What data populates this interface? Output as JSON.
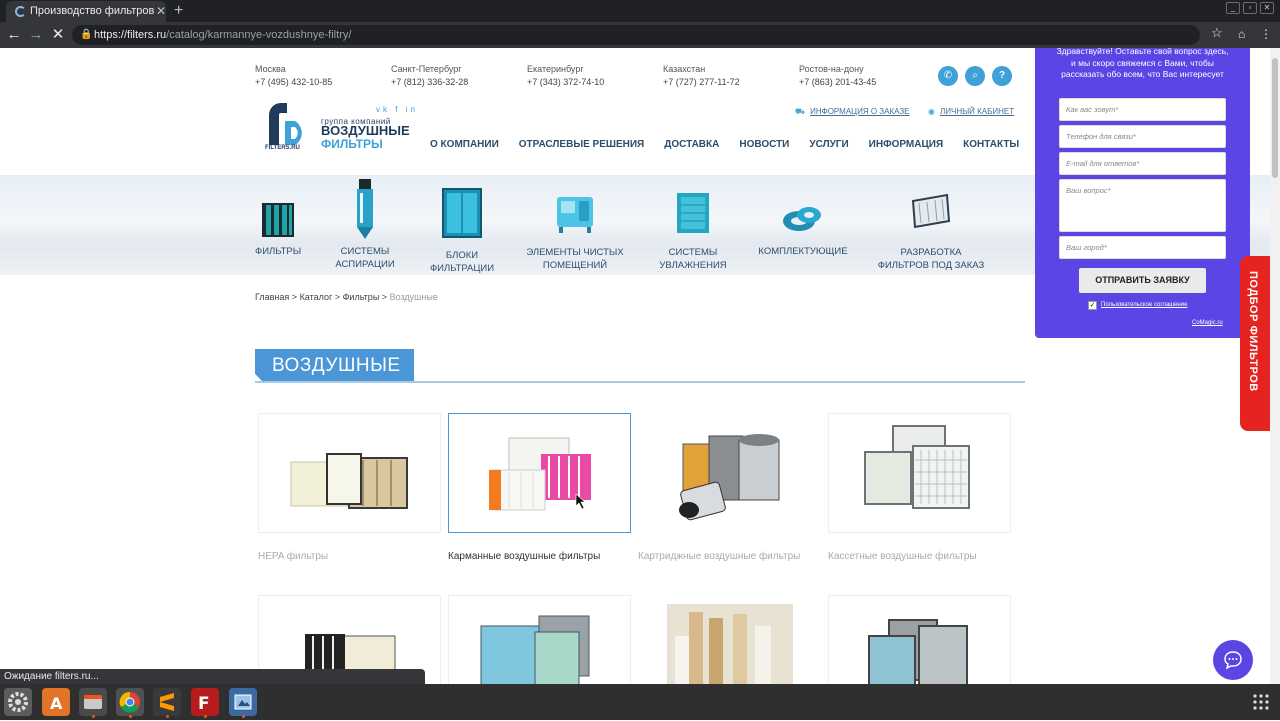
{
  "browser": {
    "tab_title": "Производство фильтров",
    "url_host": "https://filters.ru",
    "url_path": "/catalog/karmannye-vozdushnye-filtry/",
    "status": "Ожидание filters.ru..."
  },
  "contacts": [
    {
      "city": "Москва",
      "phone": "+7 (495) 432-10-85"
    },
    {
      "city": "Санкт-Петербург",
      "phone": "+7 (812) 336-32-28"
    },
    {
      "city": "Екатеринбург",
      "phone": "+7 (343) 372-74-10"
    },
    {
      "city": "Казахстан",
      "phone": "+7 (727) 277-11-72"
    },
    {
      "city": "Ростов-на-дону",
      "phone": "+7 (863) 201-43-45"
    }
  ],
  "logo": {
    "sub": "группа компаний",
    "line1": "ВОЗДУШНЫЕ",
    "line2": "ФИЛЬТРЫ",
    "tag": "FILTERS.RU",
    "social": "vk f in"
  },
  "toplinks": {
    "order_info": "ИНФОРМАЦИЯ О ЗАКАЗЕ",
    "cabinet": "ЛИЧНЫЙ КАБИНЕТ"
  },
  "nav": [
    "О КОМПАНИИ",
    "ОТРАСЛЕВЫЕ РЕШЕНИЯ",
    "ДОСТАВКА",
    "НОВОСТИ",
    "УСЛУГИ",
    "ИНФОРМАЦИЯ",
    "КОНТАКТЫ"
  ],
  "categories": [
    {
      "l1": "ФИЛЬТРЫ",
      "l2": ""
    },
    {
      "l1": "СИСТЕМЫ",
      "l2": "АСПИРАЦИИ"
    },
    {
      "l1": "БЛОКИ",
      "l2": "ФИЛЬТРАЦИИ"
    },
    {
      "l1": "ЭЛЕМЕНТЫ ЧИСТЫХ",
      "l2": "ПОМЕЩЕНИЙ"
    },
    {
      "l1": "СИСТЕМЫ",
      "l2": "УВЛАЖНЕНИЯ"
    },
    {
      "l1": "КОМПЛЕКТУЮЩИЕ",
      "l2": ""
    },
    {
      "l1": "РАЗРАБОТКА",
      "l2": "ФИЛЬТРОВ ПОД ЗАКАЗ"
    }
  ],
  "breadcrumb": {
    "home": "Главная",
    "catalog": "Каталог",
    "filters": "Фильтры",
    "current": "Воздушные",
    "sep": ">"
  },
  "page_title": "ВОЗДУШНЫЕ",
  "products": [
    "HEPA фильтры",
    "Карманные воздушные фильтры",
    "Картриджные воздушные фильтры",
    "Кассетные воздушные фильтры"
  ],
  "widget": {
    "text": "Здравствуйте! Оставьте свой вопрос здесь, и мы скоро свяжемся с Вами, чтобы рассказать обо всем, что Вас интересует",
    "name_ph": "Как вас зовут*",
    "phone_ph": "Телефон для связи*",
    "email_ph": "E-mail для ответов*",
    "question_ph": "Ваш вопрос*",
    "city_ph": "Ваш город*",
    "submit": "ОТПРАВИТЬ ЗАЯВКУ",
    "agreement": "Пользовательское соглашение",
    "brand": "CoMagic.ru"
  },
  "side_tab": "ПОДБОР ФИЛЬТРОВ",
  "colors": {
    "accent": "#4a96d6",
    "widget": "#5b45e4",
    "red": "#e52421"
  }
}
